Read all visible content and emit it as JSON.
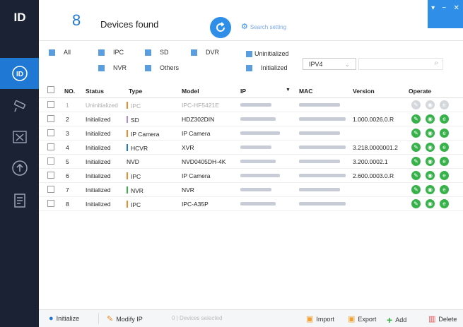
{
  "sidebar": {
    "logo": "ID"
  },
  "header": {
    "count": "8",
    "found_label": "Devices found",
    "search_setting": "Search setting"
  },
  "filters": {
    "all": "All",
    "ipc": "IPC",
    "sd": "SD",
    "dvr": "DVR",
    "nvr": "NVR",
    "others": "Others",
    "uninitialized": "Uninitialized",
    "initialized": "Initialized",
    "ip_version": "IPV4"
  },
  "table": {
    "headers": {
      "no": "NO.",
      "status": "Status",
      "type": "Type",
      "model": "Model",
      "ip": "IP",
      "mac": "MAC",
      "version": "Version",
      "operate": "Operate"
    },
    "rows": [
      {
        "no": "1",
        "status": "Uninitialized",
        "type": "IPC",
        "model": "IPC-HF5421E",
        "version": "",
        "bar_color": "#f08a24"
      },
      {
        "no": "2",
        "status": "Initialized",
        "type": "SD",
        "model": "HDZ302DIN",
        "version": "1.000.0026.0.R",
        "bar_color": "#b58ad8"
      },
      {
        "no": "3",
        "status": "Initialized",
        "type": "IP Camera",
        "model": "IP Camera",
        "version": "",
        "bar_color": "#f08a24"
      },
      {
        "no": "4",
        "status": "Initialized",
        "type": "HCVR",
        "model": "XVR",
        "version": "3.218.0000001.2",
        "bar_color": "#1f78d4"
      },
      {
        "no": "5",
        "status": "Initialized",
        "type": "NVD",
        "model": "NVD0405DH-4K",
        "version": "3.200.0002.1",
        "bar_color": ""
      },
      {
        "no": "6",
        "status": "Initialized",
        "type": "IPC",
        "model": "IP Camera",
        "version": "2.600.0003.0.R",
        "bar_color": "#f08a24"
      },
      {
        "no": "7",
        "status": "Initialized",
        "type": "NVR",
        "model": "NVR",
        "version": "",
        "bar_color": "#37b24a"
      },
      {
        "no": "8",
        "status": "Initialized",
        "type": "IPC",
        "model": "IPC-A35P",
        "version": "",
        "bar_color": "#f08a24"
      }
    ]
  },
  "footer": {
    "initialize": "Initialize",
    "modify_ip": "Modify IP",
    "selected": "0 | Devices selected",
    "import": "Import",
    "export": "Export",
    "add": "Add",
    "delete": "Delete"
  },
  "colors": {
    "accent": "#1f78d4",
    "sidebar": "#1a2233",
    "op_green": "#37b24a"
  }
}
